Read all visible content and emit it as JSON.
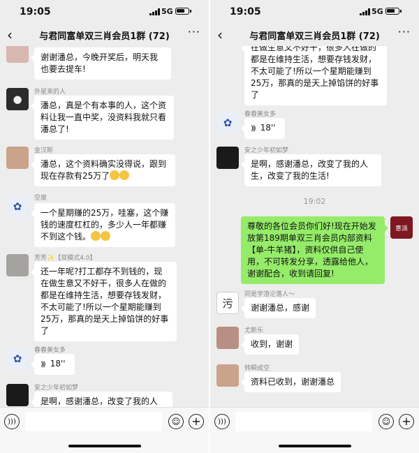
{
  "status": {
    "time": "19:05",
    "network": "5G"
  },
  "header": {
    "back_icon": "‹",
    "title": "与君同富单双三肖会员1群 (72)",
    "more_icon": "···"
  },
  "left": {
    "m1_text": "谢谢潘总，今晚开奖后，明天我也要去提车!",
    "m2_nick": "外星来的人",
    "m2_text": "潘总，真是个有本事的人，这个资料让我一直中奖，没资料我就只看潘总了!",
    "m3_nick": "金汉斯",
    "m3_text": "潘总，这个资料确实没得说，跟到现在存款有25万了",
    "m4_nick": "空度",
    "m4_text": "一个星期赚的25万，哇塞，这个赚钱的速度杠杠的，多少人一年都赚不到这个钱。",
    "m5_nick": "芳芳✨【双模式4.0】",
    "m5_text": "还一年呢?打工都存不到钱的，现在做生意又不好干，很多人在做的都是在维持生活，想要存钱发财，不太可能了!所以一个星期能赚到25万，那真的是天上掉馅饼的好事了",
    "m6_nick": "春春美女多",
    "m6_voice": "18''",
    "m7_nick": "安之少年初如梦",
    "m7_text": "是啊，感谢潘总，改变了我的人"
  },
  "right": {
    "m1_text": "在做生意又不好干，很多人在做的都是在维持生活，想要存钱发财，不太可能了!所以一个星期能赚到25万，那真的是天上掉馅饼的好事了",
    "m2_nick": "春春美女多",
    "m2_voice": "18''",
    "m3_nick": "安之少年初如梦",
    "m3_text": "是啊，感谢潘总，改变了我的人生，改变了我的生活!",
    "timestamp": "19:02",
    "m4_text": "尊敬的各位会员你们好!现在开始发放第189期单双三肖会员内部资料【单-牛羊猪】，资料仅供自己使用，不可转发分享，透露给他人，谢谢配合，收到请回复!",
    "m5_nick": "同是学渣沦落人～",
    "m5_text": "谢谢潘总，感谢",
    "m6_nick": "尤新乐",
    "m6_text": "收到，谢谢",
    "m7_nick": "转瞬成空",
    "m7_text": "资料已收到，谢谢潘总"
  },
  "icons": {
    "voice": "voice-icon",
    "emoji": "emoji-icon",
    "plus": "plus-icon"
  }
}
